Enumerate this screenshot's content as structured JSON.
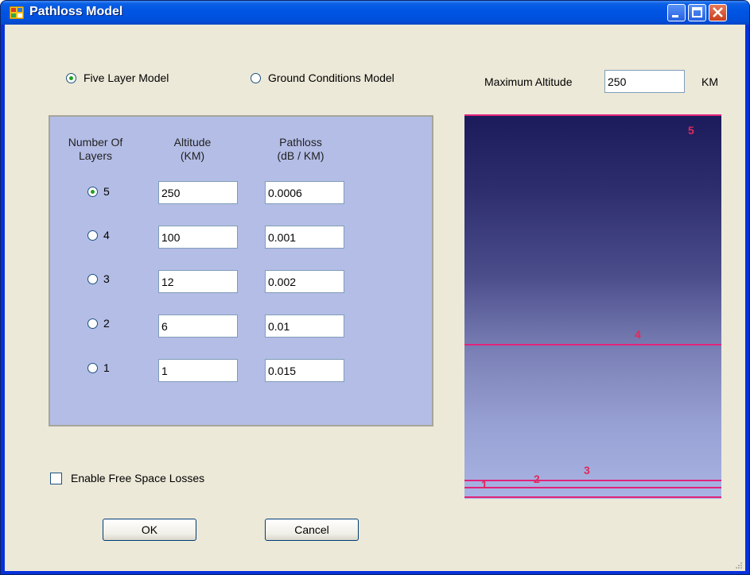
{
  "window": {
    "title": "Pathloss Model",
    "app_icon": "window-app-icon"
  },
  "model_choice": {
    "five_layer": {
      "label": "Five Layer Model",
      "selected": true
    },
    "ground_conditions": {
      "label": "Ground Conditions Model",
      "selected": false
    }
  },
  "max_altitude": {
    "label": "Maximum Altitude",
    "value": "250",
    "unit": "KM"
  },
  "table": {
    "headers": {
      "layers": "Number Of\nLayers",
      "altitude": "Altitude\n(KM)",
      "pathloss": "Pathloss\n(dB / KM)"
    },
    "rows": [
      {
        "layer": "5",
        "altitude": "250",
        "pathloss": "0.0006",
        "selected": true
      },
      {
        "layer": "4",
        "altitude": "100",
        "pathloss": "0.001",
        "selected": false
      },
      {
        "layer": "3",
        "altitude": "12",
        "pathloss": "0.002",
        "selected": false
      },
      {
        "layer": "2",
        "altitude": "6",
        "pathloss": "0.01",
        "selected": false
      },
      {
        "layer": "1",
        "altitude": "1",
        "pathloss": "0.015",
        "selected": false
      }
    ]
  },
  "free_space": {
    "label": "Enable Free Space Losses",
    "checked": false
  },
  "buttons": {
    "ok": "OK",
    "cancel": "Cancel"
  },
  "diagram": {
    "labels": [
      "5",
      "4",
      "3",
      "2",
      "1"
    ],
    "line_color": "#e0247a",
    "label_color": "#e02a5a"
  }
}
